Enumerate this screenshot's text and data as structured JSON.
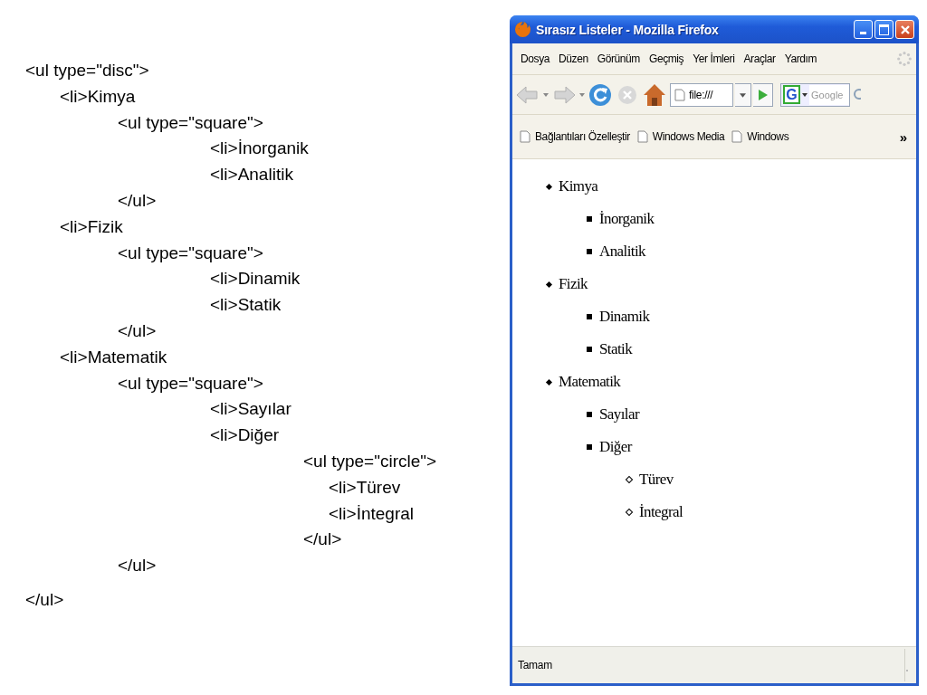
{
  "code_listing": [
    {
      "text": "<ul type=\"disc\">",
      "children": [
        {
          "text": "<li>Kimya",
          "children": [
            {
              "text": "<ul type=\"square\">",
              "children": [
                {
                  "text": "<li>İnorganik"
                },
                {
                  "text": "<li>Analitik"
                }
              ]
            },
            {
              "text": "</ul>"
            }
          ]
        },
        {
          "text": "<li>Fizik",
          "children": [
            {
              "text": "<ul type=\"square\">",
              "children": [
                {
                  "text": "<li>Dinamik"
                },
                {
                  "text": "<li>Statik"
                }
              ]
            },
            {
              "text": "</ul>"
            }
          ]
        },
        {
          "text": "<li>Matematik",
          "children": [
            {
              "text": "<ul type=\"square\">",
              "children": [
                {
                  "text": "<li>Sayılar"
                },
                {
                  "text": "<li>Diğer",
                  "children": [
                    {
                      "text": "<ul type=\"circle\">",
                      "children": [
                        {
                          "text": "<li>Türev"
                        },
                        {
                          "text": "<li>İntegral"
                        }
                      ]
                    },
                    {
                      "text": "</ul>"
                    }
                  ]
                }
              ]
            },
            {
              "text": "</ul>"
            }
          ]
        }
      ]
    },
    {
      "text": "</ul>"
    }
  ],
  "window": {
    "title": "Sırasız Listeler - Mozilla Firefox"
  },
  "menu": [
    {
      "label": "Dosya"
    },
    {
      "label": "Düzen"
    },
    {
      "label": "Görünüm"
    },
    {
      "label": "Geçmiş"
    },
    {
      "label": "Yer İmleri"
    },
    {
      "label": "Araçlar"
    },
    {
      "label": "Yardım"
    }
  ],
  "toolbar": {
    "back": {
      "disabled": true
    },
    "forward": {
      "disabled": true
    },
    "stop": {
      "disabled": true
    },
    "url": "file:///",
    "search": {
      "engine": "G",
      "placeholder": "Google"
    }
  },
  "bookmarks": [
    {
      "label": "Bağlantıları Özelleştir"
    },
    {
      "label": "Windows Media"
    },
    {
      "label": "Windows"
    }
  ],
  "bookmarks_overflow": "»",
  "page": {
    "list": [
      {
        "text": "Kimya",
        "kind": "disc",
        "children": [
          {
            "text": "İnorganik",
            "kind": "square"
          },
          {
            "text": "Analitik",
            "kind": "square"
          }
        ]
      },
      {
        "text": "Fizik",
        "kind": "disc",
        "children": [
          {
            "text": "Dinamik",
            "kind": "square"
          },
          {
            "text": "Statik",
            "kind": "square"
          }
        ]
      },
      {
        "text": "Matematik",
        "kind": "disc",
        "children": [
          {
            "text": "Sayılar",
            "kind": "square"
          },
          {
            "text": "Diğer",
            "kind": "square",
            "children": [
              {
                "text": "Türev",
                "kind": "circle"
              },
              {
                "text": "İntegral",
                "kind": "circle"
              }
            ]
          }
        ]
      }
    ]
  },
  "status_bar": {
    "text": "Tamam"
  }
}
